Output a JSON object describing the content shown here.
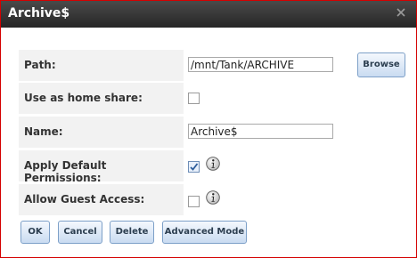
{
  "window": {
    "title": "Archive$"
  },
  "icons": {
    "close": "close-x-icon",
    "info": "info-icon"
  },
  "form": {
    "path": {
      "label": "Path:",
      "value": "/mnt/Tank/ARCHIVE",
      "browse_label": "Browse"
    },
    "home_share": {
      "label": "Use as home share:",
      "checked": false
    },
    "name": {
      "label": "Name:",
      "value": "Archive$"
    },
    "default_permissions": {
      "label": "Apply Default Permissions:",
      "checked": true
    },
    "guest_access": {
      "label": "Allow Guest Access:",
      "checked": false
    }
  },
  "buttons": {
    "ok": "OK",
    "cancel": "Cancel",
    "delete": "Delete",
    "advanced": "Advanced Mode"
  },
  "colors": {
    "titlebar": "#333333",
    "border": "#d40000",
    "label_bg": "#f2f2f2",
    "button_border": "#7da0c8"
  }
}
